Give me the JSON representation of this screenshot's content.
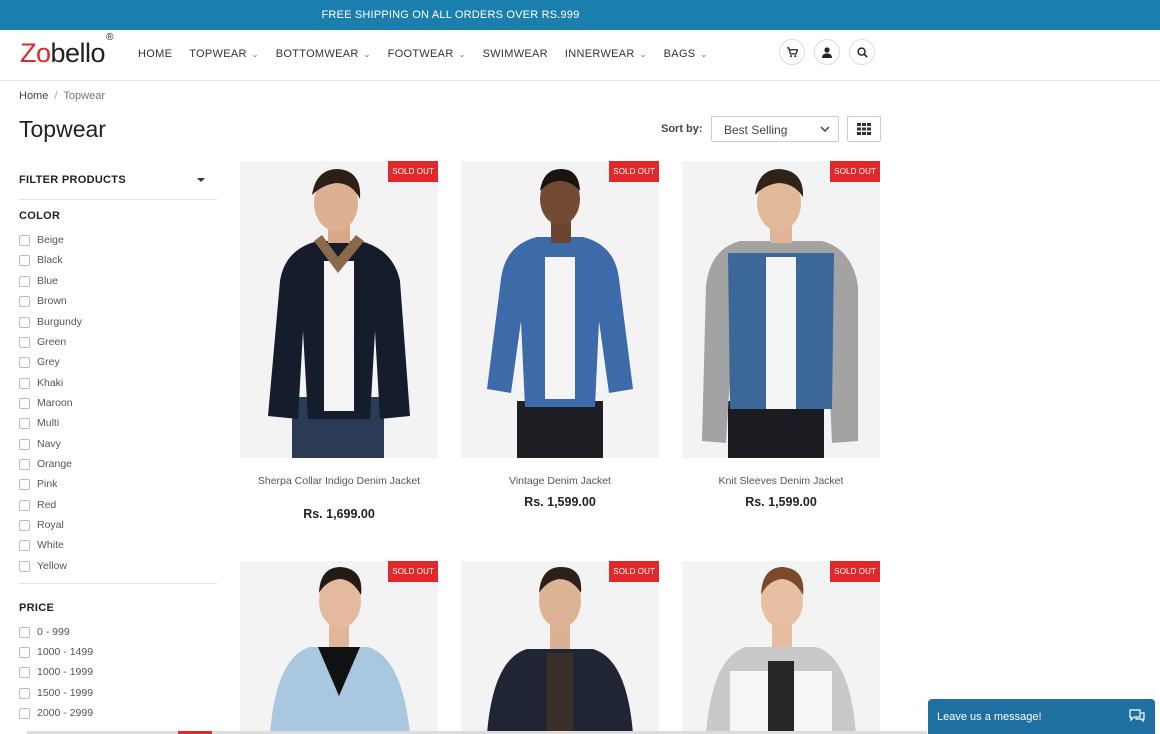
{
  "announcement": "FREE SHIPPING ON ALL ORDERS OVER RS.999",
  "brand": {
    "first_letter": "Zo",
    "rest": "bello",
    "mark": "®",
    "accent_color": "#e0262b"
  },
  "nav": [
    {
      "label": "HOME",
      "has_dropdown": false
    },
    {
      "label": "TOPWEAR",
      "has_dropdown": true
    },
    {
      "label": "BOTTOMWEAR",
      "has_dropdown": true
    },
    {
      "label": "FOOTWEAR",
      "has_dropdown": true
    },
    {
      "label": "SWIMWEAR",
      "has_dropdown": false
    },
    {
      "label": "INNERWEAR",
      "has_dropdown": true
    },
    {
      "label": "BAGS",
      "has_dropdown": true
    }
  ],
  "header_icons": [
    "cart-icon",
    "user-icon",
    "search-icon"
  ],
  "breadcrumb": {
    "home": "Home",
    "separator": "/",
    "current": "Topwear"
  },
  "page_title": "Topwear",
  "sort": {
    "label": "Sort by:",
    "selected": "Best Selling"
  },
  "filters": {
    "heading": "FILTER PRODUCTS",
    "color_title": "COLOR",
    "colors": [
      "Beige",
      "Black",
      "Blue",
      "Brown",
      "Burgundy",
      "Green",
      "Grey",
      "Khaki",
      "Maroon",
      "Multi",
      "Navy",
      "Orange",
      "Pink",
      "Red",
      "Royal",
      "White",
      "Yellow"
    ],
    "price_title": "PRICE",
    "prices": [
      "0 - 999",
      "1000 - 1499",
      "1000 - 1999",
      "1500 - 1999",
      "2000 - 2999"
    ]
  },
  "products": [
    {
      "name": "Sherpa Collar Indigo Denim Jacket",
      "price": "Rs. 1,699.00",
      "badge": "SOLD OUT"
    },
    {
      "name": "Vintage Denim Jacket",
      "price": "Rs. 1,599.00",
      "badge": "SOLD OUT"
    },
    {
      "name": "Knit Sleeves Denim Jacket",
      "price": "Rs. 1,599.00",
      "badge": "SOLD OUT"
    },
    {
      "name": "",
      "price": "",
      "badge": "SOLD OUT"
    },
    {
      "name": "",
      "price": "",
      "badge": "SOLD OUT"
    },
    {
      "name": "",
      "price": "",
      "badge": "SOLD OUT"
    }
  ],
  "chat": {
    "label": "Leave us a message!"
  },
  "colors": {
    "topbar": "#1b7fae",
    "badge": "#e3282c",
    "chat": "#1f6fa0"
  }
}
